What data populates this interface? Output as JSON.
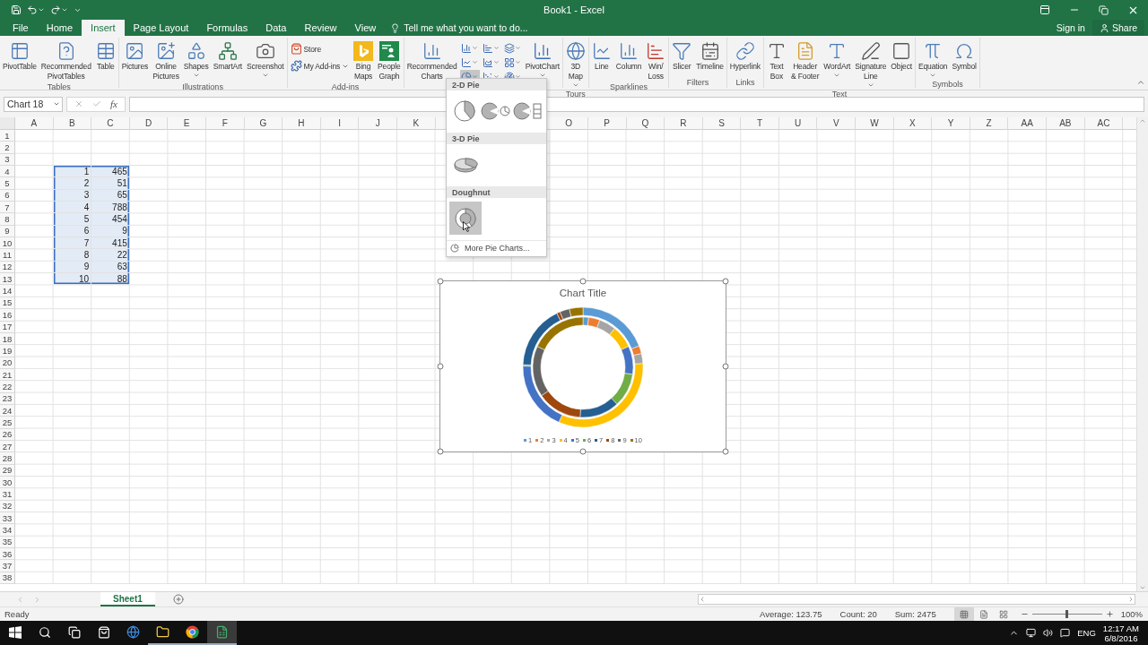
{
  "title_bar": {
    "title": "Book1 - Excel"
  },
  "ribbon_tabs": [
    {
      "label": "File",
      "selected": false
    },
    {
      "label": "Home",
      "selected": false
    },
    {
      "label": "Insert",
      "selected": true
    },
    {
      "label": "Page Layout",
      "selected": false
    },
    {
      "label": "Formulas",
      "selected": false
    },
    {
      "label": "Data",
      "selected": false
    },
    {
      "label": "Review",
      "selected": false
    },
    {
      "label": "View",
      "selected": false
    }
  ],
  "tell_me": {
    "placeholder": "Tell me what you want to do..."
  },
  "account": {
    "sign_in": "Sign in",
    "share": "Share"
  },
  "ribbon_groups": [
    {
      "label": "Tables",
      "items": [
        {
          "kind": "large",
          "label": "PivotTable"
        },
        {
          "kind": "large",
          "label": "Recommended\nPivotTables"
        },
        {
          "kind": "large",
          "label": "Table"
        }
      ]
    },
    {
      "label": "Illustrations",
      "items": [
        {
          "kind": "large",
          "label": "Pictures"
        },
        {
          "kind": "large",
          "label": "Online\nPictures"
        },
        {
          "kind": "large",
          "label": "Shapes",
          "dropdown": true
        },
        {
          "kind": "large",
          "label": "SmartArt"
        },
        {
          "kind": "large",
          "label": "Screenshot",
          "dropdown": true
        }
      ]
    },
    {
      "label": "Add-ins",
      "items": [
        {
          "kind": "stack",
          "entries": [
            {
              "label": "Store"
            },
            {
              "label": "My Add-ins",
              "dropdown": true
            }
          ]
        },
        {
          "kind": "large",
          "label": "Bing\nMaps"
        },
        {
          "kind": "large",
          "label": "People\nGraph"
        }
      ]
    },
    {
      "items": [
        {
          "kind": "large",
          "label": "Recommended\nCharts"
        },
        {
          "kind": "gallery",
          "buttons": [
            {
              "selected": false
            },
            {
              "selected": false
            },
            {
              "selected": false
            },
            {
              "selected": false
            },
            {
              "selected": false
            },
            {
              "selected": false
            },
            {
              "selected": true
            },
            {
              "selected": false
            },
            {
              "selected": false
            }
          ]
        },
        {
          "kind": "large",
          "label": "PivotChart",
          "dropdown": true
        }
      ]
    },
    {
      "label": "Tours",
      "items": [
        {
          "kind": "large",
          "label": "3D\nMap",
          "dropdown": true
        }
      ]
    },
    {
      "label": "Sparklines",
      "items": [
        {
          "kind": "large",
          "label": "Line"
        },
        {
          "kind": "large",
          "label": "Column"
        },
        {
          "kind": "large",
          "label": "Win/\nLoss"
        }
      ]
    },
    {
      "label": "Filters",
      "items": [
        {
          "kind": "large",
          "label": "Slicer"
        },
        {
          "kind": "large",
          "label": "Timeline"
        }
      ]
    },
    {
      "label": "Links",
      "items": [
        {
          "kind": "large",
          "label": "Hyperlink"
        }
      ]
    },
    {
      "label": "Text",
      "items": [
        {
          "kind": "large",
          "label": "Text\nBox"
        },
        {
          "kind": "large",
          "label": "Header\n& Footer"
        },
        {
          "kind": "large",
          "label": "WordArt",
          "dropdown": true
        },
        {
          "kind": "large",
          "label": "Signature\nLine",
          "dropdown": true
        },
        {
          "kind": "large",
          "label": "Object"
        }
      ]
    },
    {
      "label": "Symbols",
      "items": [
        {
          "kind": "large",
          "label": "Equation",
          "dropdown": true
        },
        {
          "kind": "large",
          "label": "Symbol"
        }
      ]
    }
  ],
  "formula_bar": {
    "name_box": "Chart 18",
    "function_label": "fx"
  },
  "sheet": {
    "columns": [
      "A",
      "B",
      "C",
      "D",
      "E",
      "F",
      "G",
      "H",
      "I",
      "J",
      "K",
      null,
      null,
      null,
      "O",
      "P",
      "Q",
      "R",
      "S",
      "T",
      "U",
      "V",
      "W",
      "X",
      "Y",
      "Z",
      "AA",
      "AB",
      "AC"
    ],
    "rows": [
      {
        "label": "1"
      },
      {
        "label": "2"
      },
      {
        "label": "3"
      },
      {
        "label": "4",
        "cells": [
          null,
          {
            "value": "1",
            "selected": true
          },
          {
            "value": "465",
            "selected": true
          }
        ]
      },
      {
        "label": "5",
        "cells": [
          null,
          {
            "value": "2",
            "selected": true
          },
          {
            "value": "51",
            "selected": true
          }
        ]
      },
      {
        "label": "6",
        "cells": [
          null,
          {
            "value": "3",
            "selected": true
          },
          {
            "value": "65",
            "selected": true
          }
        ]
      },
      {
        "label": "7",
        "cells": [
          null,
          {
            "value": "4",
            "selected": true
          },
          {
            "value": "788",
            "selected": true
          }
        ]
      },
      {
        "label": "8",
        "cells": [
          null,
          {
            "value": "5",
            "selected": true
          },
          {
            "value": "454",
            "selected": true
          }
        ]
      },
      {
        "label": "9",
        "cells": [
          null,
          {
            "value": "6",
            "selected": true
          },
          {
            "value": "9",
            "selected": true
          }
        ]
      },
      {
        "label": "10",
        "cells": [
          null,
          {
            "value": "7",
            "selected": true
          },
          {
            "value": "415",
            "selected": true
          }
        ]
      },
      {
        "label": "11",
        "cells": [
          null,
          {
            "value": "8",
            "selected": true
          },
          {
            "value": "22",
            "selected": true
          }
        ]
      },
      {
        "label": "12",
        "cells": [
          null,
          {
            "value": "9",
            "selected": true
          },
          {
            "value": "63",
            "selected": true
          }
        ]
      },
      {
        "label": "13",
        "cells": [
          null,
          {
            "value": "10",
            "selected": true
          },
          {
            "value": "88",
            "selected": true
          }
        ]
      },
      {
        "label": "14"
      },
      {
        "label": "15"
      },
      {
        "label": "16"
      },
      {
        "label": "17"
      },
      {
        "label": "18"
      },
      {
        "label": "19"
      },
      {
        "label": "20"
      },
      {
        "label": "21"
      },
      {
        "label": "22"
      },
      {
        "label": "23"
      },
      {
        "label": "24"
      },
      {
        "label": "25"
      },
      {
        "label": "26"
      },
      {
        "label": "27"
      },
      {
        "label": "28"
      },
      {
        "label": "29"
      },
      {
        "label": "30"
      },
      {
        "label": "31"
      },
      {
        "label": "32"
      },
      {
        "label": "33"
      },
      {
        "label": "34"
      },
      {
        "label": "35"
      },
      {
        "label": "36"
      },
      {
        "label": "37"
      },
      {
        "label": "38"
      }
    ]
  },
  "chart": {
    "selected": true,
    "chart_data": {
      "type": "donut",
      "title": "Chart Title",
      "series": [
        {
          "values": [
            1.82,
            3.64,
            5.45,
            7.27,
            9.09,
            10.91,
            12.73,
            14.55,
            16.36,
            18.18
          ],
          "colors": [
            "#5b9bd5",
            "#ed7d31",
            "#a5a5a5",
            "#ffc000",
            "#4472c4",
            "#70ad47",
            "#255e91",
            "#9e480e",
            "#636363",
            "#997300"
          ]
        },
        {
          "values": [
            19.21,
            2.11,
            2.69,
            32.56,
            18.76,
            0.37,
            17.15,
            0.91,
            2.6,
            3.64
          ],
          "colors": [
            "#5b9bd5",
            "#ed7d31",
            "#a5a5a5",
            "#ffc000",
            "#4472c4",
            "#70ad47",
            "#255e91",
            "#9e480e",
            "#636363",
            "#997300"
          ]
        }
      ]
    },
    "legend": [
      {
        "label": "1",
        "color": "#5b9bd5"
      },
      {
        "label": "2",
        "color": "#ed7d31"
      },
      {
        "label": "3",
        "color": "#a5a5a5"
      },
      {
        "label": "4",
        "color": "#ffc000"
      },
      {
        "label": "5",
        "color": "#4472c4"
      },
      {
        "label": "6",
        "color": "#70ad47"
      },
      {
        "label": "7",
        "color": "#255e91"
      },
      {
        "label": "8",
        "color": "#9e480e"
      },
      {
        "label": "9",
        "color": "#636363"
      },
      {
        "label": "10",
        "color": "#997300"
      }
    ]
  },
  "pie_menu": {
    "sections": [
      {
        "title": "2-D Pie",
        "options": [
          {
            "kind": "pie",
            "selected": false
          },
          {
            "kind": "pie_of_pie",
            "selected": false
          },
          {
            "kind": "bar_of_pie",
            "selected": false
          }
        ]
      },
      {
        "title": "3-D Pie",
        "options": [
          {
            "kind": "pie_3d",
            "selected": false
          }
        ]
      },
      {
        "title": "Doughnut",
        "options": [
          {
            "kind": "doughnut",
            "selected": true
          }
        ]
      }
    ],
    "more": "More Pie Charts..."
  },
  "sheet_tabs": [
    {
      "label": "Sheet1",
      "selected": true
    }
  ],
  "status_bar": {
    "mode": "Ready",
    "stats": [
      "Average: 123.75",
      "Count: 20",
      "Sum: 2475"
    ],
    "views": [
      {
        "selected": true
      },
      {
        "selected": false
      },
      {
        "selected": false
      }
    ],
    "zoom": {
      "level": 0.5,
      "label": "100%"
    }
  },
  "taskbar": {
    "apps": [
      {
        "running": false,
        "selected": false
      },
      {
        "running": false,
        "selected": false
      },
      {
        "running": true,
        "selected": false
      },
      {
        "running": true,
        "selected": false
      },
      {
        "running": true,
        "selected": true
      }
    ],
    "language": "ENG",
    "time": "12:17 AM",
    "date": "6/8/2016"
  }
}
